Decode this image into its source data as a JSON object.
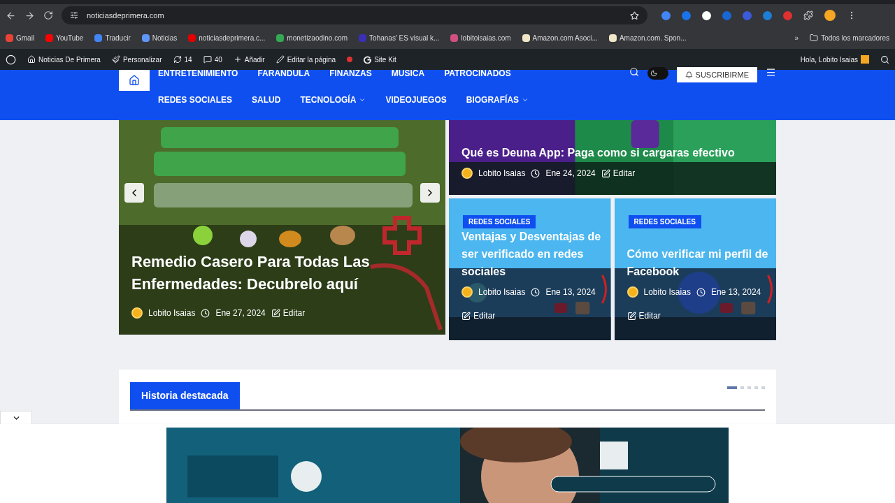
{
  "browser": {
    "url": "noticiasdeprimera.com",
    "bookmarks": [
      {
        "label": "Gmail",
        "color": "#ea4335"
      },
      {
        "label": "YouTube",
        "color": "#ff0000"
      },
      {
        "label": "Traducir",
        "color": "#4285f4"
      },
      {
        "label": "Noticias",
        "color": "#5e97f6"
      },
      {
        "label": "noticiasdeprimera.c...",
        "color": "#e00000"
      },
      {
        "label": "monetizaodino.com",
        "color": "#34a853"
      },
      {
        "label": "Tohanas' ES visual k...",
        "color": "#3a2fb5"
      },
      {
        "label": "lobitoisaias.com",
        "color": "#d05080"
      },
      {
        "label": "Amazon.com Asoci...",
        "color": "#f0e6c8"
      },
      {
        "label": "Amazon.com. Spon...",
        "color": "#f0e6c8"
      }
    ],
    "more": "»",
    "all_bookmarks": "Todos los marcadores"
  },
  "admin_bar": {
    "site": "Noticias De Primera",
    "customize": "Personalizar",
    "updates": "14",
    "comments": "40",
    "add": "Añadir",
    "edit_page": "Editar la página",
    "site_kit": "Site Kit",
    "greeting": "Hola, Lobito Isaias"
  },
  "nav": {
    "rows": [
      [
        {
          "label": "ENTRETENIMIENTO",
          "dropdown": false
        },
        {
          "label": "FARANDULA",
          "dropdown": false
        },
        {
          "label": "FINANZAS",
          "dropdown": false
        },
        {
          "label": "MUSICA",
          "dropdown": false
        },
        {
          "label": "PATROCINADOS",
          "dropdown": false
        }
      ],
      [
        {
          "label": "REDES SOCIALES",
          "dropdown": false
        },
        {
          "label": "SALUD",
          "dropdown": false
        },
        {
          "label": "TECNOLOGÍA",
          "dropdown": true
        },
        {
          "label": "VIDEOJUEGOS",
          "dropdown": false
        },
        {
          "label": "BIOGRAFÍAS",
          "dropdown": true
        }
      ]
    ],
    "subscribe": "SUSCRIBIRME",
    "dark_mode": true
  },
  "hero": {
    "main": {
      "title": "Remedio Casero Para Todas Las Enfermedades: Decubrelo aquí",
      "author": "Lobito Isaias",
      "date": "Ene 27, 2024",
      "edit": "Editar"
    },
    "top": {
      "title": "Qué es Deuna App: Paga como si cargaras efectivo",
      "author": "Lobito Isaias",
      "date": "Ene 24, 2024",
      "edit": "Editar"
    },
    "cards": [
      {
        "category": "REDES SOCIALES",
        "title": "Ventajas y Desventajas de ser verificado en redes sociales",
        "author": "Lobito Isaias",
        "date": "Ene 13, 2024",
        "edit": "Editar"
      },
      {
        "category": "REDES SOCIALES",
        "title": "Cómo verificar mi perfil de Facebook",
        "author": "Lobito Isaias",
        "date": "Ene 13, 2024",
        "edit": "Editar"
      }
    ]
  },
  "featured": {
    "title": "Historia destacada",
    "dots": [
      {
        "selected": true
      },
      {
        "selected": false
      },
      {
        "selected": false
      },
      {
        "selected": false
      },
      {
        "selected": false
      }
    ]
  }
}
